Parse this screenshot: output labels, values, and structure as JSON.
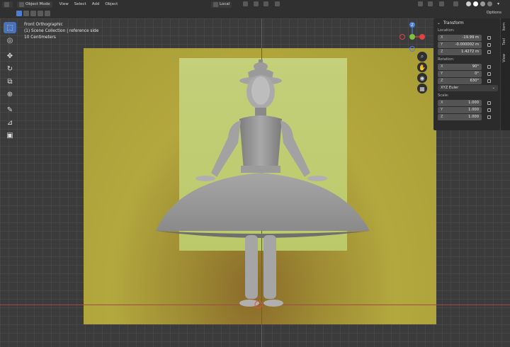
{
  "header": {
    "mode": "Object Mode",
    "menus": [
      "View",
      "Select",
      "Add",
      "Object"
    ],
    "orientation": "Local",
    "options": "Options"
  },
  "overlay": {
    "view_name": "Front Orthographic",
    "collection": "(1) Scene Collection | reference side",
    "scale": "10 Centimeters"
  },
  "toolbar": {
    "tools": [
      "select-box",
      "cursor",
      "move",
      "rotate",
      "scale",
      "transform",
      "annotate",
      "measure",
      "add-cube"
    ],
    "active": "select-box"
  },
  "gizmo": {
    "z": "Z",
    "x_color": "#e14343",
    "y_color": "#7ec13a",
    "z_color": "#4a7fdc"
  },
  "transform_panel": {
    "title": "Transform",
    "location_label": "Location:",
    "location": [
      {
        "axis": "X",
        "value": "-19.99 m"
      },
      {
        "axis": "Y",
        "value": "-0.000002 m"
      },
      {
        "axis": "Z",
        "value": "1.4272 m"
      }
    ],
    "rotation_label": "Rotation:",
    "rotation": [
      {
        "axis": "X",
        "value": "90°"
      },
      {
        "axis": "Y",
        "value": "0°"
      },
      {
        "axis": "Z",
        "value": "630°"
      }
    ],
    "rotation_mode": "XYZ Euler",
    "scale_label": "Scale:",
    "scale": [
      {
        "axis": "X",
        "value": "1.000"
      },
      {
        "axis": "Y",
        "value": "1.000"
      },
      {
        "axis": "Z",
        "value": "1.000"
      }
    ]
  },
  "side_tabs": [
    "Item",
    "Tool",
    "View"
  ],
  "colors": {
    "active_accent": "#4a72b8",
    "viewport_bg": "#3b3b3b",
    "reference_yellow": "#b3a83e"
  }
}
